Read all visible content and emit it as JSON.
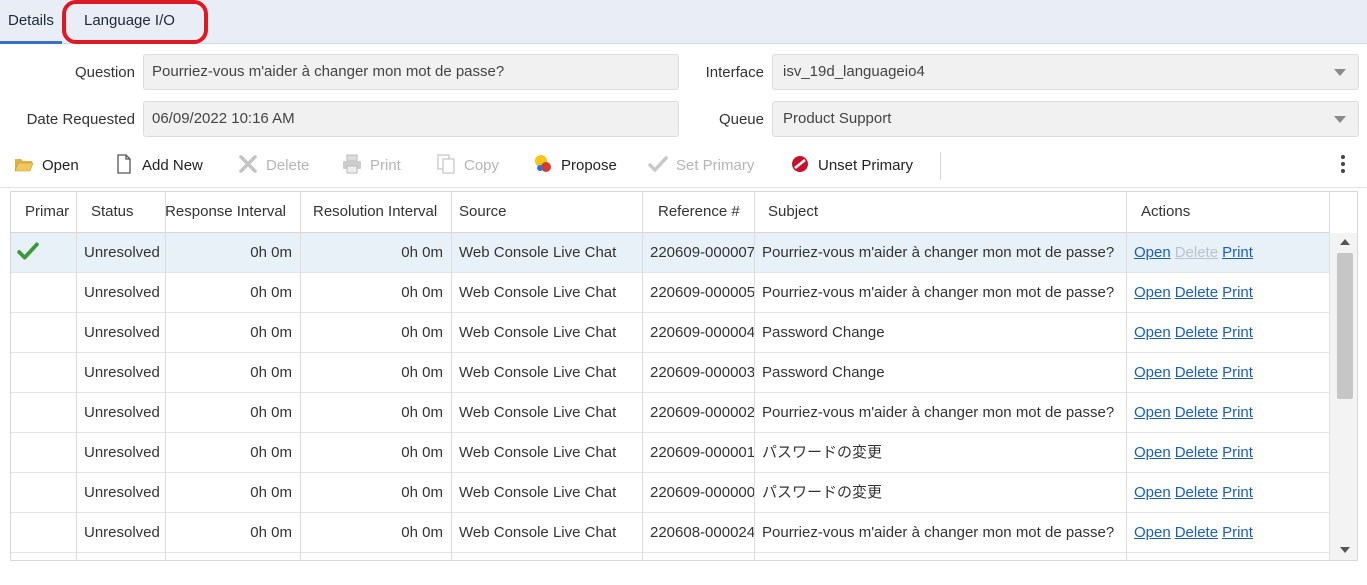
{
  "tabs": [
    {
      "label": "Details"
    },
    {
      "label": "Language I/O"
    }
  ],
  "form": {
    "question_label": "Question",
    "question_value": "Pourriez-vous m'aider à changer mon mot de passe?",
    "date_label": "Date Requested",
    "date_value": "06/09/2022 10:16 AM",
    "interface_label": "Interface",
    "interface_value": "isv_19d_languageio4",
    "queue_label": "Queue",
    "queue_value": "Product Support"
  },
  "toolbar": {
    "open": "Open",
    "add_new": "Add New",
    "delete": "Delete",
    "print": "Print",
    "copy": "Copy",
    "propose": "Propose",
    "set_primary": "Set Primary",
    "unset_primary": "Unset Primary"
  },
  "table": {
    "columns": [
      "Primar",
      "Status",
      "Response Interval",
      "Resolution Interval",
      "Source",
      "Reference #",
      "Subject",
      "Actions"
    ],
    "actions": {
      "open": "Open",
      "delete": "Delete",
      "print": "Print"
    },
    "rows": [
      {
        "primary": true,
        "status": "Unresolved",
        "response": "0h 0m",
        "resolution": "0h 0m",
        "source": "Web Console Live Chat",
        "reference": "220609-000007",
        "subject": "Pourriez-vous m'aider à changer mon mot de passe?"
      },
      {
        "primary": false,
        "status": "Unresolved",
        "response": "0h 0m",
        "resolution": "0h 0m",
        "source": "Web Console Live Chat",
        "reference": "220609-000005",
        "subject": "Pourriez-vous m'aider à changer mon mot de passe?"
      },
      {
        "primary": false,
        "status": "Unresolved",
        "response": "0h 0m",
        "resolution": "0h 0m",
        "source": "Web Console Live Chat",
        "reference": "220609-000004",
        "subject": "Password Change"
      },
      {
        "primary": false,
        "status": "Unresolved",
        "response": "0h 0m",
        "resolution": "0h 0m",
        "source": "Web Console Live Chat",
        "reference": "220609-000003",
        "subject": "Password Change"
      },
      {
        "primary": false,
        "status": "Unresolved",
        "response": "0h 0m",
        "resolution": "0h 0m",
        "source": "Web Console Live Chat",
        "reference": "220609-000002",
        "subject": "Pourriez-vous m'aider à changer mon mot de passe?"
      },
      {
        "primary": false,
        "status": "Unresolved",
        "response": "0h 0m",
        "resolution": "0h 0m",
        "source": "Web Console Live Chat",
        "reference": "220609-000001",
        "subject": "パスワードの変更"
      },
      {
        "primary": false,
        "status": "Unresolved",
        "response": "0h 0m",
        "resolution": "0h 0m",
        "source": "Web Console Live Chat",
        "reference": "220609-000000",
        "subject": "パスワードの変更"
      },
      {
        "primary": false,
        "status": "Unresolved",
        "response": "0h 0m",
        "resolution": "0h 0m",
        "source": "Web Console Live Chat",
        "reference": "220608-000024",
        "subject": "Pourriez-vous m'aider à changer mon mot de passe?"
      }
    ]
  }
}
